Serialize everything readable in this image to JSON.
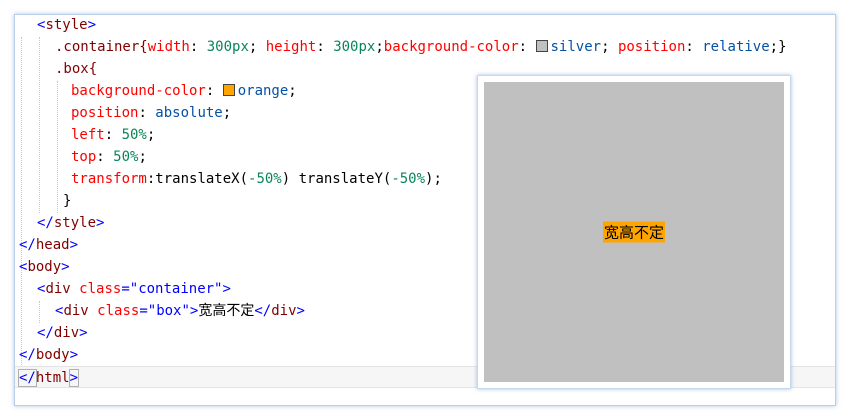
{
  "code": {
    "l1": {
      "open": "<",
      "tag": "style",
      "close": ">"
    },
    "l2": {
      "selector": ".container{",
      "p1": "width",
      "c1": ": ",
      "v1": "300px",
      "s1": "; ",
      "p2": "height",
      "c2": ": ",
      "v2": "300px",
      "s2": ";",
      "p3": "background-color",
      "c3": ": ",
      "v3": "silver",
      "s3": "; ",
      "p4": "position",
      "c4": ": ",
      "v4": "relative",
      "s4": ";}"
    },
    "l3": {
      "selector": ".box{"
    },
    "l4": {
      "prop": "background-color",
      "colon": ": ",
      "val": "orange",
      "semi": ";"
    },
    "l5": {
      "prop": "position",
      "colon": ": ",
      "val": "absolute",
      "semi": ";"
    },
    "l6": {
      "prop": "left",
      "colon": ": ",
      "val": "50%",
      "semi": ";"
    },
    "l7": {
      "prop": "top",
      "colon": ": ",
      "val": "50%",
      "semi": ";"
    },
    "l8": {
      "prop": "transform",
      "colon": ":",
      "fn1": "translateX(",
      "a1": "-50%",
      "cp1": ") ",
      "fn2": "translateY(",
      "a2": "-50%",
      "cp2": ");"
    },
    "l9": {
      "brace": "}"
    },
    "l10": {
      "open": "</",
      "tag": "style",
      "close": ">"
    },
    "l11": {
      "open": "</",
      "tag": "head",
      "close": ">"
    },
    "l12": {
      "open": "<",
      "tag": "body",
      "close": ">"
    },
    "l13": {
      "open": "<",
      "tag": "div",
      "attr": "class",
      "eq": "=",
      "val": "\"container\"",
      "close": ">"
    },
    "l14": {
      "open": "<",
      "tag": "div",
      "attr": "class",
      "eq": "=",
      "val": "\"box\"",
      "close": ">",
      "text": "宽高不定",
      "open2": "</",
      "tag2": "div",
      "close2": ">"
    },
    "l15": {
      "open": "</",
      "tag": "div",
      "close": ">"
    },
    "l16": {
      "open": "</",
      "tag": "body",
      "close": ">"
    },
    "l17": {
      "open": "</",
      "tag": "html",
      "close": ">"
    }
  },
  "preview": {
    "box_text": "宽高不定"
  },
  "colors": {
    "silver": "#c0c0c0",
    "orange": "#ffa500"
  }
}
